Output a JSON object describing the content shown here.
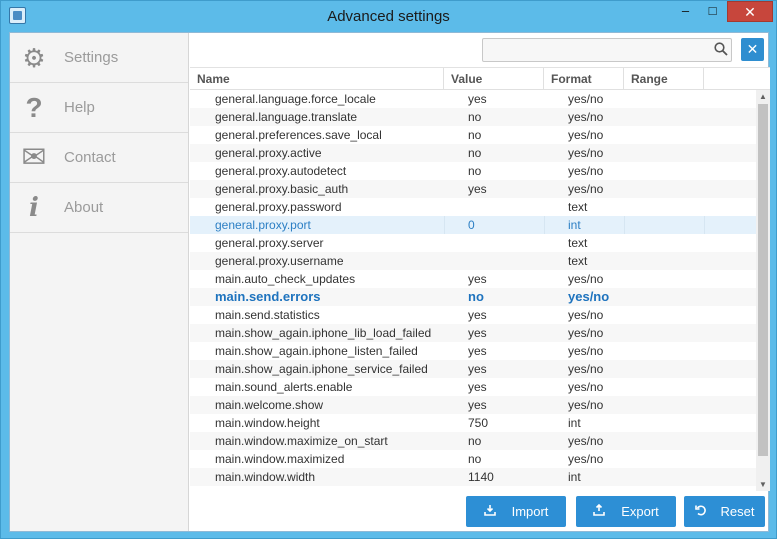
{
  "window": {
    "title": "Advanced settings",
    "minimize_glyph": "–",
    "maximize_glyph": "□",
    "close_glyph": "✕"
  },
  "sidebar": {
    "items": [
      {
        "label": "Settings",
        "icon": "gear-icon",
        "glyph": "⚙"
      },
      {
        "label": "Help",
        "icon": "question-icon",
        "glyph": "?"
      },
      {
        "label": "Contact",
        "icon": "envelope-icon",
        "glyph": "✉"
      },
      {
        "label": "About",
        "icon": "info-icon",
        "glyph": "i"
      }
    ]
  },
  "search": {
    "value": "",
    "placeholder": "",
    "clear_glyph": "✕"
  },
  "table": {
    "columns": [
      "Name",
      "Value",
      "Format",
      "Range"
    ],
    "rows": [
      {
        "name": "general.language.force_locale",
        "value": "yes",
        "format": "yes/no"
      },
      {
        "name": "general.language.translate",
        "value": "no",
        "format": "yes/no"
      },
      {
        "name": "general.preferences.save_local",
        "value": "no",
        "format": "yes/no"
      },
      {
        "name": "general.proxy.active",
        "value": "no",
        "format": "yes/no"
      },
      {
        "name": "general.proxy.autodetect",
        "value": "no",
        "format": "yes/no"
      },
      {
        "name": "general.proxy.basic_auth",
        "value": "yes",
        "format": "yes/no"
      },
      {
        "name": "general.proxy.password",
        "value": "",
        "format": "text"
      },
      {
        "name": "general.proxy.port",
        "value": "0",
        "format": "int",
        "selected": true
      },
      {
        "name": "general.proxy.server",
        "value": "",
        "format": "text"
      },
      {
        "name": "general.proxy.username",
        "value": "",
        "format": "text"
      },
      {
        "name": "main.auto_check_updates",
        "value": "yes",
        "format": "yes/no"
      },
      {
        "name": "main.send.errors",
        "value": "no",
        "format": "yes/no",
        "bold": true
      },
      {
        "name": "main.send.statistics",
        "value": "yes",
        "format": "yes/no"
      },
      {
        "name": "main.show_again.iphone_lib_load_failed",
        "value": "yes",
        "format": "yes/no"
      },
      {
        "name": "main.show_again.iphone_listen_failed",
        "value": "yes",
        "format": "yes/no"
      },
      {
        "name": "main.show_again.iphone_service_failed",
        "value": "yes",
        "format": "yes/no"
      },
      {
        "name": "main.sound_alerts.enable",
        "value": "yes",
        "format": "yes/no"
      },
      {
        "name": "main.welcome.show",
        "value": "yes",
        "format": "yes/no"
      },
      {
        "name": "main.window.height",
        "value": "750",
        "format": "int"
      },
      {
        "name": "main.window.maximize_on_start",
        "value": "no",
        "format": "yes/no"
      },
      {
        "name": "main.window.maximized",
        "value": "no",
        "format": "yes/no"
      },
      {
        "name": "main.window.width",
        "value": "1140",
        "format": "int"
      }
    ]
  },
  "footer": {
    "import_label": "Import",
    "export_label": "Export",
    "reset_label": "Reset"
  },
  "colors": {
    "accent": "#2d8fd5",
    "selected_row": "#e4f1fb",
    "close_button": "#c7463c"
  }
}
